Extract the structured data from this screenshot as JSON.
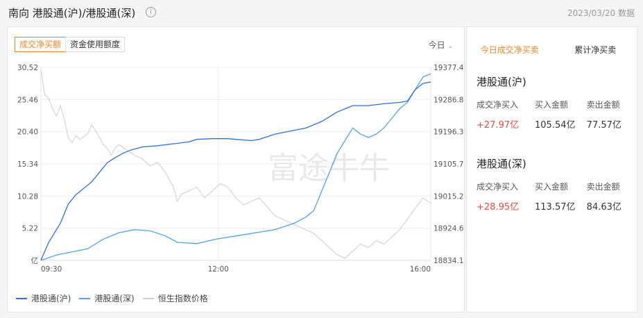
{
  "header": {
    "title": "南向 港股通(沪)/港股通(深)",
    "info_icon": "info-icon",
    "date": "2023/03/20 数据"
  },
  "left": {
    "tabs": [
      {
        "label": "成交净买额",
        "active": true
      },
      {
        "label": "资金使用额度",
        "active": false
      }
    ],
    "period": "今日",
    "watermark": "富途牛牛",
    "legend": [
      "港股通(沪)",
      "港股通(深)",
      "恒生指数价格"
    ]
  },
  "colors": {
    "accent": "#f0862a",
    "positive": "#e84a3d",
    "sh": "#2f6fd6",
    "sz": "#4fa3f0",
    "hsi": "#c9ced6"
  },
  "chart_data": {
    "type": "line",
    "x_ticks": [
      "09:30",
      "12:00",
      "16:00"
    ],
    "left_axis": {
      "unit": "亿",
      "ticks": [
        "30.52",
        "25.46",
        "20.40",
        "15.34",
        "10.28",
        "5.22"
      ],
      "range": [
        0.16,
        30.52
      ]
    },
    "right_axis": {
      "ticks": [
        "19377.4",
        "19286.8",
        "19196.3",
        "19105.7",
        "19015.2",
        "18924.6",
        "18834.1"
      ],
      "range": [
        18834.1,
        19377.4
      ]
    },
    "series": [
      {
        "name": "港股通(沪)",
        "axis": "left",
        "points": [
          [
            0,
            0.2
          ],
          [
            0.02,
            3
          ],
          [
            0.05,
            6
          ],
          [
            0.07,
            9
          ],
          [
            0.09,
            10.5
          ],
          [
            0.11,
            11.5
          ],
          [
            0.13,
            12.5
          ],
          [
            0.15,
            14
          ],
          [
            0.17,
            15.5
          ],
          [
            0.19,
            16.3
          ],
          [
            0.21,
            17
          ],
          [
            0.23,
            17.5
          ],
          [
            0.26,
            18
          ],
          [
            0.3,
            18.2
          ],
          [
            0.34,
            18.5
          ],
          [
            0.38,
            18.8
          ],
          [
            0.4,
            19.2
          ],
          [
            0.44,
            19.3
          ],
          [
            0.48,
            19.3
          ],
          [
            0.5,
            19.2
          ],
          [
            0.54,
            19
          ],
          [
            0.56,
            19.2
          ],
          [
            0.58,
            19.6
          ],
          [
            0.6,
            20
          ],
          [
            0.64,
            20.5
          ],
          [
            0.68,
            21
          ],
          [
            0.72,
            22
          ],
          [
            0.76,
            23.5
          ],
          [
            0.8,
            24.5
          ],
          [
            0.84,
            24.5
          ],
          [
            0.88,
            24.8
          ],
          [
            0.92,
            25
          ],
          [
            0.94,
            25.2
          ],
          [
            0.96,
            27
          ],
          [
            0.98,
            28
          ],
          [
            1,
            28.2
          ]
        ]
      },
      {
        "name": "港股通(深)",
        "axis": "left",
        "points": [
          [
            0,
            0.16
          ],
          [
            0.04,
            1
          ],
          [
            0.08,
            1.5
          ],
          [
            0.12,
            2
          ],
          [
            0.16,
            3.5
          ],
          [
            0.2,
            4.5
          ],
          [
            0.24,
            5
          ],
          [
            0.28,
            4.8
          ],
          [
            0.32,
            4
          ],
          [
            0.35,
            3
          ],
          [
            0.4,
            2.8
          ],
          [
            0.45,
            3.5
          ],
          [
            0.5,
            4
          ],
          [
            0.55,
            4.5
          ],
          [
            0.6,
            5
          ],
          [
            0.65,
            6
          ],
          [
            0.68,
            7
          ],
          [
            0.7,
            8
          ],
          [
            0.72,
            11
          ],
          [
            0.74,
            14
          ],
          [
            0.76,
            17
          ],
          [
            0.78,
            19
          ],
          [
            0.8,
            21
          ],
          [
            0.82,
            20
          ],
          [
            0.84,
            19.5
          ],
          [
            0.86,
            20
          ],
          [
            0.88,
            21
          ],
          [
            0.9,
            22.5
          ],
          [
            0.92,
            24
          ],
          [
            0.94,
            25
          ],
          [
            0.96,
            27
          ],
          [
            0.98,
            29
          ],
          [
            1,
            29.5
          ]
        ]
      },
      {
        "name": "恒生指数价格",
        "axis": "right",
        "points": [
          [
            0,
            19370
          ],
          [
            0.01,
            19300
          ],
          [
            0.02,
            19290
          ],
          [
            0.03,
            19260
          ],
          [
            0.04,
            19240
          ],
          [
            0.05,
            19270
          ],
          [
            0.06,
            19230
          ],
          [
            0.07,
            19180
          ],
          [
            0.08,
            19165
          ],
          [
            0.09,
            19185
          ],
          [
            0.1,
            19175
          ],
          [
            0.12,
            19190
          ],
          [
            0.13,
            19215
          ],
          [
            0.14,
            19200
          ],
          [
            0.15,
            19180
          ],
          [
            0.16,
            19160
          ],
          [
            0.17,
            19150
          ],
          [
            0.18,
            19130
          ],
          [
            0.19,
            19150
          ],
          [
            0.2,
            19160
          ],
          [
            0.22,
            19145
          ],
          [
            0.24,
            19130
          ],
          [
            0.26,
            19120
          ],
          [
            0.28,
            19100
          ],
          [
            0.3,
            19110
          ],
          [
            0.32,
            19080
          ],
          [
            0.34,
            19040
          ],
          [
            0.35,
            19000
          ],
          [
            0.36,
            19020
          ],
          [
            0.38,
            19030
          ],
          [
            0.4,
            19040
          ],
          [
            0.42,
            19010
          ],
          [
            0.44,
            19030
          ],
          [
            0.46,
            19050
          ],
          [
            0.48,
            19040
          ],
          [
            0.5,
            19010
          ],
          [
            0.52,
            18990
          ],
          [
            0.54,
            19000
          ],
          [
            0.56,
            19010
          ],
          [
            0.58,
            18985
          ],
          [
            0.6,
            18960
          ],
          [
            0.62,
            18950
          ],
          [
            0.64,
            18940
          ],
          [
            0.66,
            18930
          ],
          [
            0.68,
            18920
          ],
          [
            0.7,
            18910
          ],
          [
            0.72,
            18890
          ],
          [
            0.74,
            18870
          ],
          [
            0.76,
            18850
          ],
          [
            0.78,
            18840
          ],
          [
            0.8,
            18860
          ],
          [
            0.82,
            18880
          ],
          [
            0.84,
            18870
          ],
          [
            0.86,
            18890
          ],
          [
            0.88,
            18880
          ],
          [
            0.9,
            18900
          ],
          [
            0.92,
            18920
          ],
          [
            0.94,
            18950
          ],
          [
            0.96,
            18980
          ],
          [
            0.98,
            19010
          ],
          [
            1,
            18995
          ]
        ]
      }
    ]
  },
  "right": {
    "tabs": [
      {
        "label": "今日成交净买卖",
        "active": true
      },
      {
        "label": "累计净买卖",
        "active": false
      }
    ],
    "sections": [
      {
        "title": "港股通(沪)",
        "headers": [
          "成交净买入",
          "买入金额",
          "卖出金额"
        ],
        "values": [
          "+27.97亿",
          "105.54亿",
          "77.57亿"
        ]
      },
      {
        "title": "港股通(深)",
        "headers": [
          "成交净买入",
          "买入金额",
          "卖出金额"
        ],
        "values": [
          "+28.95亿",
          "113.57亿",
          "84.63亿"
        ]
      }
    ]
  }
}
